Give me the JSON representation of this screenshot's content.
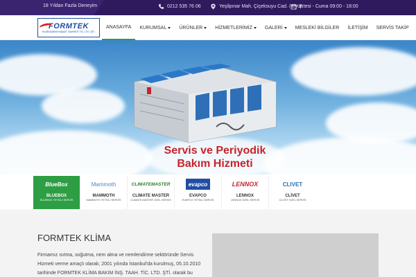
{
  "topbar": {
    "tagline": "18 Yıldan Fazla Deneyim",
    "phone": "0212 535 76 06",
    "address": "Yeşilpınar Mah. Çiçeksuyu Cad. / Eyüp",
    "hours": "P.tesi - Cuma 09:00 - 18:00"
  },
  "logo": {
    "brand": "FORMTEK",
    "sub": "KLİMA BAKIM İNŞAAT TAAHHÜT TİC. LTD. ŞTİ."
  },
  "nav": {
    "home": "ANASAYFA",
    "corporate": "KURUMSAL",
    "products": "ÜRÜNLER",
    "services": "HİZMETLERİMİZ",
    "gallery": "GALERİ",
    "info": "MESLEKİ BİLGİLER",
    "contact": "İLETİŞİM",
    "tracking": "SERVİS TAKİP"
  },
  "hero": {
    "line1": "Servis ve Periyodik",
    "line2": "Bakım Hizmeti"
  },
  "brands": [
    {
      "logo": "BlueBox",
      "name": "BLUEBOX",
      "desc": "BLUEBOX YETKİLİ SERVİS"
    },
    {
      "logo": "Mammoth",
      "name": "MAMMOTH",
      "desc": "MAMMOTH YETKİLİ SERVİS"
    },
    {
      "logo": "CLIMATEMASTER",
      "name": "CLIMATE MASTER",
      "desc": "CLIMATE MASTER ÖZEL SERVİS"
    },
    {
      "logo": "evapco",
      "name": "EVAPCO",
      "desc": "EVAPCO YETKİLİ SERVİS"
    },
    {
      "logo": "LENNOX",
      "name": "LENNOX",
      "desc": "LENNOX ÖZEL SERVİS"
    },
    {
      "logo": "CLIVET",
      "name": "CLİVET",
      "desc": "CLİVET ÖZEL SERVİS"
    }
  ],
  "about": {
    "title": "FORMTEK KLİMA",
    "text": "Firmamız ısıtma, soğutma, nem alma ve nemlendirme sektöründe Servis Hizmeti verme amaçlı olarak; 2001 yılında İstanbul'da kurulmuş, 05.10.2010 tarihinde FORMTEK KLİMA BAKIM İNŞ. TAAH. TİC. LTD. ŞTİ. olarak bu günlere"
  },
  "colors": {
    "topbar": "#2e1a5c",
    "accent_green": "#2d9e43",
    "hero_red": "#c8232c",
    "brand_blue": "#1f4ea3"
  }
}
